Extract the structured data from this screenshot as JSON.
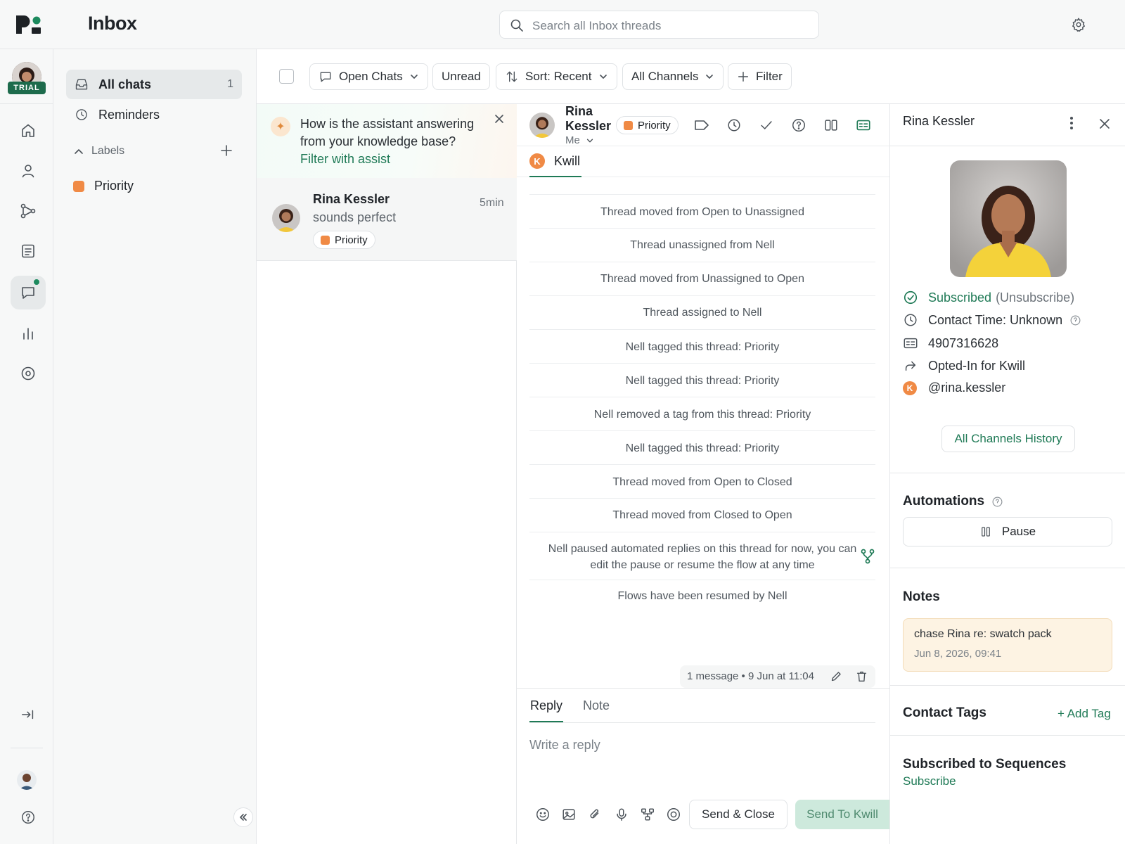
{
  "app": {
    "title": "Inbox",
    "search_placeholder": "Search all Inbox threads",
    "trial_badge": "TRIAL"
  },
  "sidebar": {
    "all_chats": {
      "label": "All chats",
      "count": "1"
    },
    "reminders": "Reminders",
    "labels_heading": "Labels",
    "labels": [
      {
        "name": "Priority",
        "color": "#f08a45"
      }
    ]
  },
  "toolbar": {
    "open_chats": "Open Chats",
    "unread": "Unread",
    "sort": "Sort: Recent",
    "channels": "All Channels",
    "filter": "Filter"
  },
  "assist_banner": {
    "question": "How is the assistant answering from your knowledge base?",
    "link": "Filter with assist"
  },
  "conversations": [
    {
      "name": "Rina Kessler",
      "preview": "sounds perfect",
      "time": "5min",
      "tag": "Priority"
    }
  ],
  "thread": {
    "contact_first": "Rina",
    "contact_last": "Kessler",
    "tag": "Priority",
    "assignee": "Me",
    "channel_initial": "K",
    "channel": "Kwill",
    "events": [
      "Thread moved from Open to Unassigned",
      "Thread unassigned from Nell",
      "Thread moved from Unassigned to Open",
      "Thread assigned to Nell",
      "Nell tagged this thread: Priority",
      "Nell tagged this thread: Priority",
      "Nell removed a tag from this thread: Priority",
      "Nell tagged this thread: Priority",
      "Thread moved from Open to Closed",
      "Thread moved from Closed to Open",
      "Nell paused automated replies on this thread for now, you can edit the pause or resume the flow at any time",
      "Flows have been resumed by Nell"
    ],
    "message_meta": "1 message • 9 Jun at 11:04",
    "reply_tab": "Reply",
    "note_tab": "Note",
    "reply_placeholder": "Write a reply",
    "send_close": "Send & Close",
    "send_to": "Send To Kwill"
  },
  "contact": {
    "name": "Rina Kessler",
    "subscribed": "Subscribed",
    "unsubscribe": "(Unsubscribe)",
    "contact_time": "Contact Time: Unknown",
    "phone": "4907316628",
    "opted_in": "Opted-In for Kwill",
    "handle_initial": "K",
    "handle": "@rina.kessler",
    "history_button": "All Channels History",
    "automations_title": "Automations",
    "pause_label": "Pause",
    "notes_title": "Notes",
    "note_text": "chase Rina re: swatch pack",
    "note_date": "Jun 8, 2026, 09:41",
    "tags_title": "Contact Tags",
    "add_tag": "+ Add Tag",
    "sequences_title": "Subscribed to Sequences",
    "subscribe_link": "Subscribe"
  },
  "colors": {
    "accent_green": "#1f7a56",
    "priority_orange": "#f08a45",
    "note_bg": "#fdf3e3",
    "send_disabled_bg": "#cde9dc"
  }
}
